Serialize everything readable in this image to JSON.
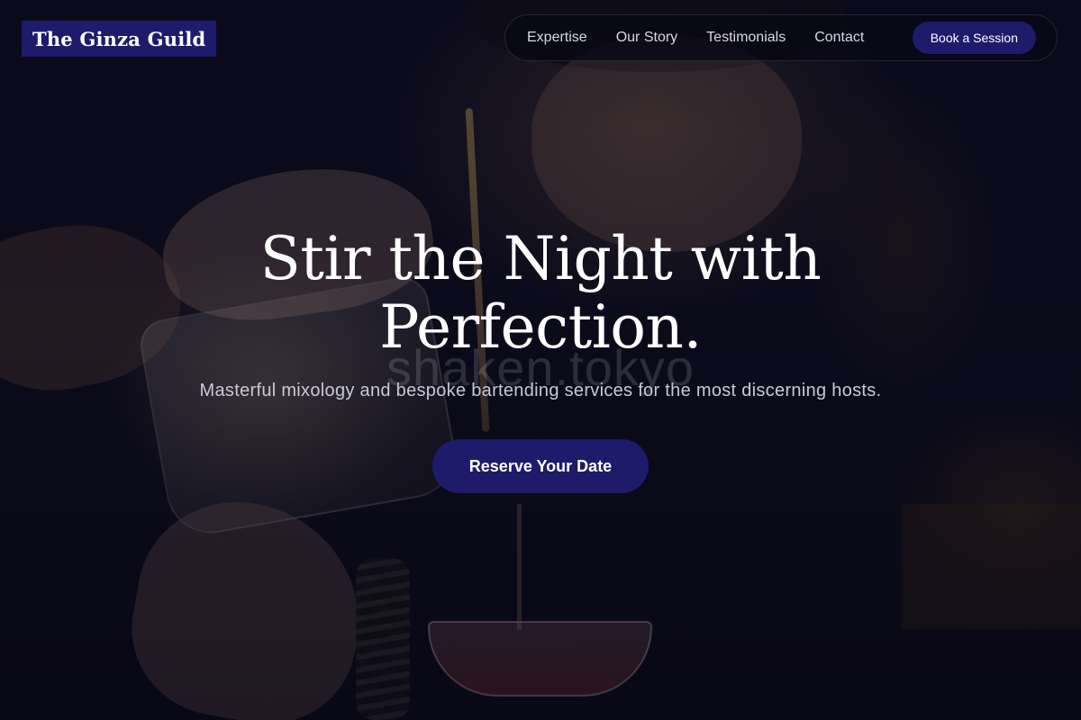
{
  "header": {
    "brand": "The Ginza Guild",
    "nav": [
      {
        "label": "Expertise"
      },
      {
        "label": "Our Story"
      },
      {
        "label": "Testimonials"
      },
      {
        "label": "Contact"
      }
    ],
    "cta_label": "Book a Session"
  },
  "hero": {
    "title_line1": "Stir the Night with",
    "title_line2": "Perfection.",
    "watermark": "shaken.tokyo",
    "subtitle": "Masterful mixology and bespoke bartending services for the most discerning hosts.",
    "cta_label": "Reserve Your Date"
  },
  "colors": {
    "accent": "#1e1b6b",
    "background": "#07071a",
    "text": "#ffffff",
    "muted_text": "#c9c8d6"
  }
}
